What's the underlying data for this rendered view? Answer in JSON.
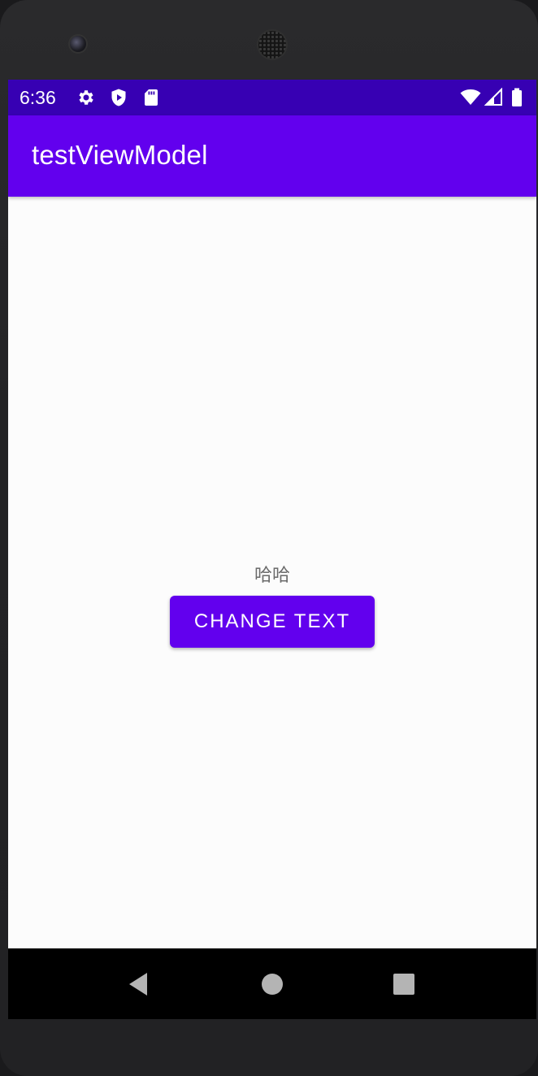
{
  "status_bar": {
    "time": "6:36",
    "left_icons": [
      "settings-icon",
      "shield-play-icon",
      "sd-card-icon"
    ],
    "right_icons": [
      "wifi-icon",
      "cell-signal-icon",
      "battery-icon"
    ],
    "background_color": "#3700b3"
  },
  "app_bar": {
    "title": "testViewModel",
    "background_color": "#6200ee"
  },
  "main": {
    "message_text": "哈哈",
    "change_text_button_label": "CHANGE TEXT",
    "button_color": "#6200ee"
  },
  "navigation_bar": {
    "buttons": [
      "back-icon",
      "home-icon",
      "recents-icon"
    ]
  }
}
